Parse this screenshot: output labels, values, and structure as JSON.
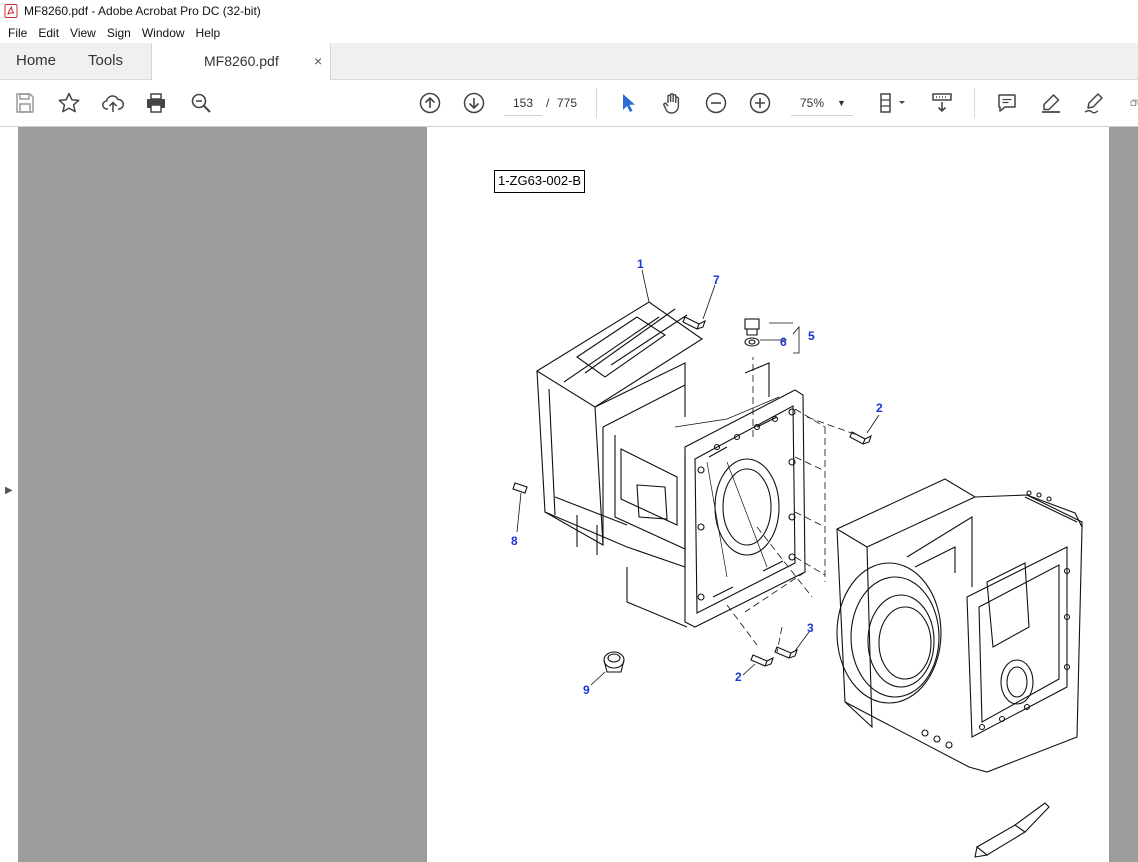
{
  "window": {
    "title": "MF8260.pdf - Adobe Acrobat Pro DC (32-bit)"
  },
  "menu": [
    "File",
    "Edit",
    "View",
    "Sign",
    "Window",
    "Help"
  ],
  "tabs": {
    "home": "Home",
    "tools": "Tools",
    "document": "MF8260.pdf",
    "close_glyph": "×"
  },
  "toolbar": {
    "page_current": "153",
    "page_separator": "/",
    "page_total": "775",
    "zoom": "75%",
    "zoom_caret": "▼",
    "icons": [
      "save-icon",
      "bookmark-star-icon",
      "upload-icon",
      "print-icon",
      "search-zoom-icon",
      "page-up-icon",
      "page-down-icon",
      "select-cursor-icon",
      "hand-icon",
      "zoom-out-icon",
      "zoom-in-icon",
      "page-fit-icon",
      "scroll-mode-icon",
      "comment-icon",
      "highlight-pen-icon",
      "sign-pen-icon",
      "more-tools-icon"
    ]
  },
  "viewer": {
    "left_panel_toggle": "▶",
    "drawing_code": "1-ZG63-002-B",
    "callouts": [
      "1",
      "7",
      "5",
      "6",
      "2",
      "8",
      "3",
      "2",
      "9"
    ],
    "colors": {
      "callout": "#1a35d6",
      "canvas_gray": "#9d9d9d",
      "accent_blue": "#2b6cd4"
    }
  }
}
